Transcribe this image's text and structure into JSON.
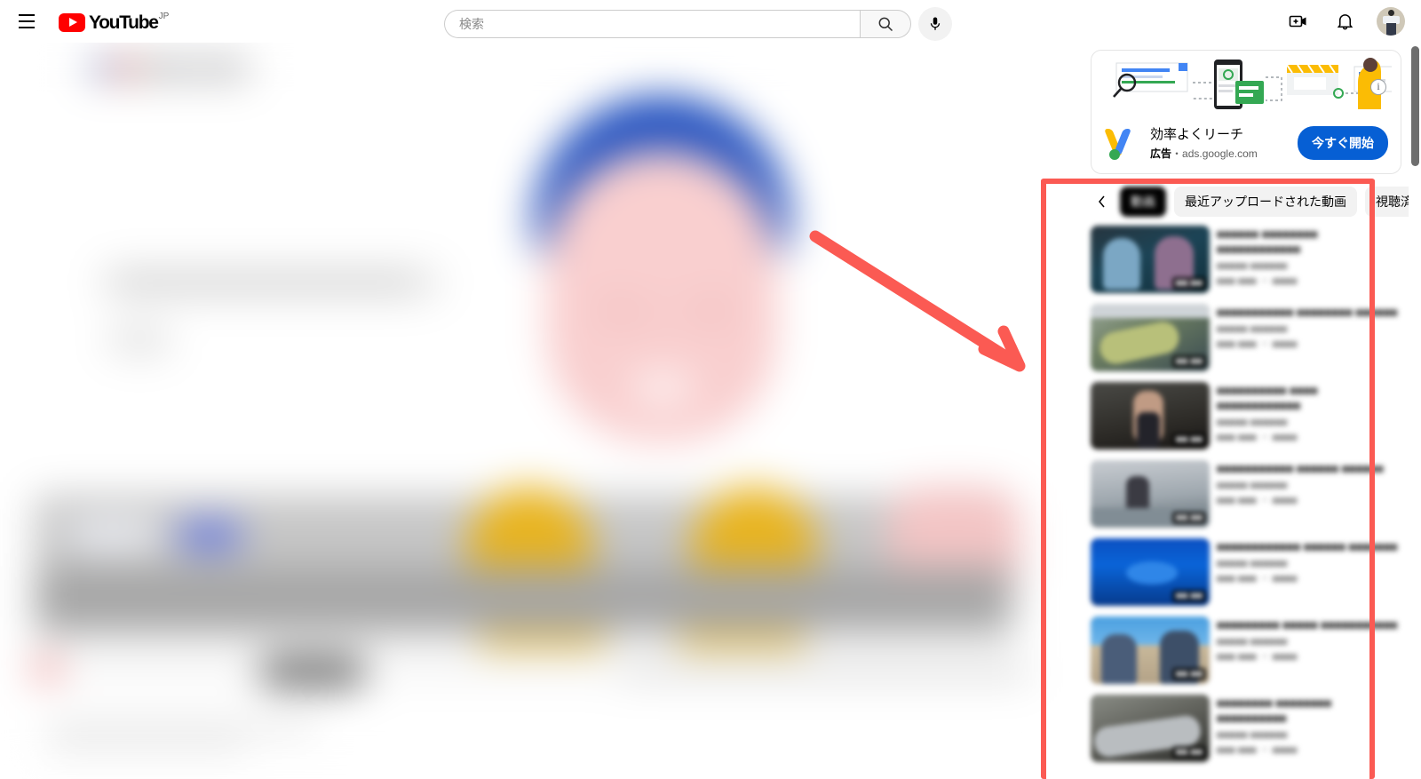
{
  "topbar": {
    "menu_icon": "hamburger-menu-icon",
    "logo_text": "YouTube",
    "logo_country": "JP",
    "search": {
      "value": "",
      "placeholder": "検索"
    },
    "search_icon": "search-icon",
    "mic_icon": "microphone-icon",
    "create_icon": "create-video-icon",
    "notifications_icon": "bell-notifications-icon",
    "avatar_name": "account-avatar"
  },
  "ad": {
    "info_icon": "info-icon",
    "title": "効率よくリーチ",
    "label": "広告",
    "separator": "・",
    "domain": "ads.google.com",
    "cta": "今すぐ開始",
    "brand": "google-ads-logo"
  },
  "chips": {
    "back_icon": "chevron-left-icon",
    "items": [
      {
        "label": "動画",
        "selected": true
      },
      {
        "label": "最近アップロードされた動画",
        "selected": false
      },
      {
        "label": "視聴済み",
        "selected": false
      }
    ]
  },
  "annotation": {
    "arrow_color": "#fb5a53",
    "rect_color": "#fb5a53",
    "arrow_from": "915,265",
    "arrow_to": "1152,414"
  },
  "videos": [
    {
      "title": "■■■■■■ ■■■■■■■■ ■■■■■■■■■■■■",
      "channel": "■■■■■ ■■■■■■",
      "stats": "■■■ ■■■ ・ ■■■■",
      "duration": "■■:■■",
      "scene": "sc-a"
    },
    {
      "title": "■■■■■■■■■■■ ■■■■■■■■ ■■■■■■",
      "channel": "■■■■■ ■■■■■■",
      "stats": "■■■ ■■■ ・ ■■■■",
      "duration": "■■:■■",
      "scene": "sc-b"
    },
    {
      "title": "■■■■■■■■■■ ■■■■ ■■■■■■■■■■■■",
      "channel": "■■■■■ ■■■■■■",
      "stats": "■■■ ■■■ ・ ■■■■",
      "duration": "■■:■■",
      "scene": "sc-c"
    },
    {
      "title": "■■■■■■■■■■■ ■■■■■■ ■■■■■■",
      "channel": "■■■■■ ■■■■■■",
      "stats": "■■■ ■■■ ・ ■■■■",
      "duration": "■■:■■",
      "scene": "sc-d"
    },
    {
      "title": "■■■■■■■■■■■■ ■■■■■■ ■■■■■■■",
      "channel": "■■■■■ ■■■■■■",
      "stats": "■■■ ■■■ ・ ■■■■",
      "duration": "■■:■■",
      "scene": "sc-e"
    },
    {
      "title": "■■■■■■■■■ ■■■■■ ■■■■■■■■■■■",
      "channel": "■■■■■ ■■■■■■",
      "stats": "■■■ ■■■ ・ ■■■■",
      "duration": "■■:■■",
      "scene": "sc-f"
    },
    {
      "title": "■■■■■■■■ ■■■■■■■■ ■■■■■■■■■■",
      "channel": "■■■■■ ■■■■■■",
      "stats": "■■■ ■■■ ・ ■■■■",
      "duration": "■■:■■",
      "scene": "sc-g"
    }
  ]
}
